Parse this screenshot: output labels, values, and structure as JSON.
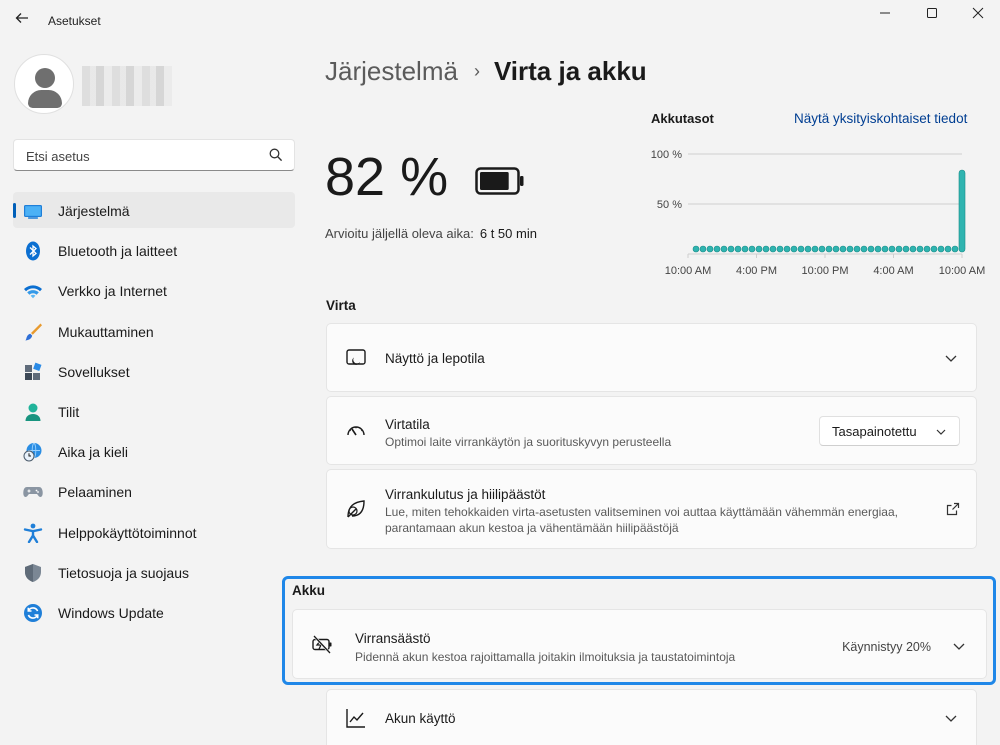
{
  "window": {
    "title": "Asetukset",
    "back_icon": "arrow-left-icon",
    "minimize_icon": "minimize-icon",
    "maximize_icon": "maximize-icon",
    "close_icon": "close-icon"
  },
  "sidebar": {
    "search": {
      "placeholder": "Etsi asetus"
    },
    "items": [
      {
        "label": "Järjestelmä",
        "icon": "system-icon",
        "active": true
      },
      {
        "label": "Bluetooth ja laitteet",
        "icon": "bluetooth-icon"
      },
      {
        "label": "Verkko ja Internet",
        "icon": "wifi-icon"
      },
      {
        "label": "Mukauttaminen",
        "icon": "brush-icon"
      },
      {
        "label": "Sovellukset",
        "icon": "apps-icon"
      },
      {
        "label": "Tilit",
        "icon": "account-icon"
      },
      {
        "label": "Aika ja kieli",
        "icon": "time-language-icon"
      },
      {
        "label": "Pelaaminen",
        "icon": "gamepad-icon"
      },
      {
        "label": "Helppokäyttötoiminnot",
        "icon": "accessibility-icon"
      },
      {
        "label": "Tietosuoja ja suojaus",
        "icon": "shield-icon"
      },
      {
        "label": "Windows Update",
        "icon": "update-icon"
      }
    ]
  },
  "main": {
    "breadcrumb": {
      "parent": "Järjestelmä",
      "separator": "›",
      "current": "Virta ja akku"
    },
    "battery": {
      "percent_text": "82 %",
      "percent": 82,
      "estimate_label": "Arvioitu jäljellä oleva aika:",
      "estimate_value": "6 t 50 min"
    },
    "chart_header": {
      "title": "Akkutasot",
      "link": "Näytä yksityiskohtaiset tiedot"
    },
    "sections": {
      "power": "Virta",
      "battery": "Akku"
    },
    "cards": {
      "screen_sleep": {
        "title": "Näyttö ja lepotila"
      },
      "power_mode": {
        "title": "Virtatila",
        "desc": "Optimoi laite virrankäytön ja suorituskyvyn perusteella",
        "dropdown_value": "Tasapainotettu"
      },
      "energy": {
        "title": "Virrankulutus ja hiilipäästöt",
        "desc": "Lue, miten tehokkaiden virta-asetusten valitseminen voi auttaa käyttämään vähemmän energiaa, parantamaan akun kestoa ja vähentämään hiilipäästöjä"
      },
      "battery_saver": {
        "title": "Virransäästö",
        "desc": "Pidennä akun kestoa rajoittamalla joitakin ilmoituksia ja taustatoimintoja",
        "status": "Käynnistyy 20%"
      },
      "battery_usage": {
        "title": "Akun käyttö"
      }
    },
    "colors": {
      "accent": "#005fb8",
      "chart_bar": "#2fb4b0",
      "focus": "#1f87e8"
    }
  },
  "chart_data": {
    "type": "bar",
    "title": "Akkutasot",
    "xlabel": "",
    "ylabel": "",
    "ylim": [
      0,
      100
    ],
    "y_ticks": [
      "100 %",
      "50 %"
    ],
    "x_tick_labels": [
      "10:00 AM",
      "4:00 PM",
      "10:00 PM",
      "4:00 AM",
      "10:00 AM"
    ],
    "values": [
      0,
      0,
      0,
      0,
      0,
      0,
      0,
      0,
      0,
      0,
      0,
      0,
      0,
      0,
      0,
      0,
      0,
      0,
      0,
      0,
      0,
      0,
      0,
      0,
      0,
      0,
      0,
      0,
      0,
      0,
      0,
      0,
      0,
      0,
      0,
      0,
      0,
      0,
      82
    ],
    "grid": true
  }
}
